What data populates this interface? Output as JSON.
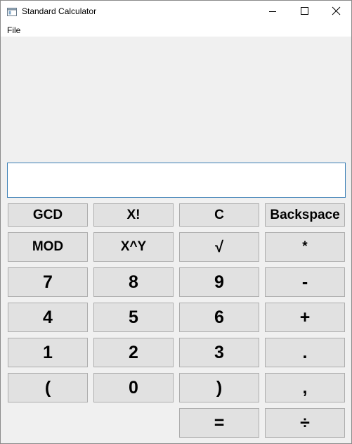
{
  "window": {
    "title": "Standard Calculator"
  },
  "menu": {
    "file_label": "File"
  },
  "display": {
    "value": ""
  },
  "keys": {
    "gcd": "GCD",
    "factorial": "X!",
    "clear": "C",
    "backspace": "Backspace",
    "mod": "MOD",
    "power": "X^Y",
    "sqrt": "√",
    "multiply": "*",
    "seven": "7",
    "eight": "8",
    "nine": "9",
    "minus": "-",
    "four": "4",
    "five": "5",
    "six": "6",
    "plus": "+",
    "one": "1",
    "two": "2",
    "three": "3",
    "decimal": ".",
    "open_paren": "(",
    "zero": "0",
    "close_paren": ")",
    "comma": ",",
    "equals": "=",
    "divide": "÷"
  },
  "icons": {
    "app": "calculator-app-icon",
    "minimize": "minimize-icon",
    "maximize": "maximize-icon",
    "close": "close-icon"
  },
  "colors": {
    "button_face": "#e1e1e1",
    "button_border": "#adadad",
    "window_background": "#f0f0f0",
    "display_border": "#3a7fb5"
  }
}
